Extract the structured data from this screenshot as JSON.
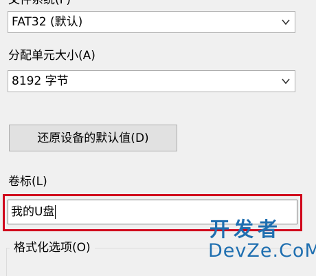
{
  "dialog": {
    "filesystem": {
      "label": "文件系统(F)",
      "value": "FAT32 (默认)"
    },
    "allocation": {
      "label": "分配单元大小(A)",
      "value": "8192 字节"
    },
    "restore_button": "还原设备的默认值(D)",
    "volume": {
      "label": "卷标(L)",
      "value": "我的U盘"
    },
    "format_options": {
      "label": "格式化选项(O)"
    }
  },
  "watermark": {
    "line1": "开发者",
    "line2": "DevZe.CoM"
  },
  "colors": {
    "highlight": "#d0021b",
    "watermark": "#1f6fb0",
    "background": "#f0f0f0"
  },
  "icons": {
    "dropdown": "chevron-down-icon"
  }
}
